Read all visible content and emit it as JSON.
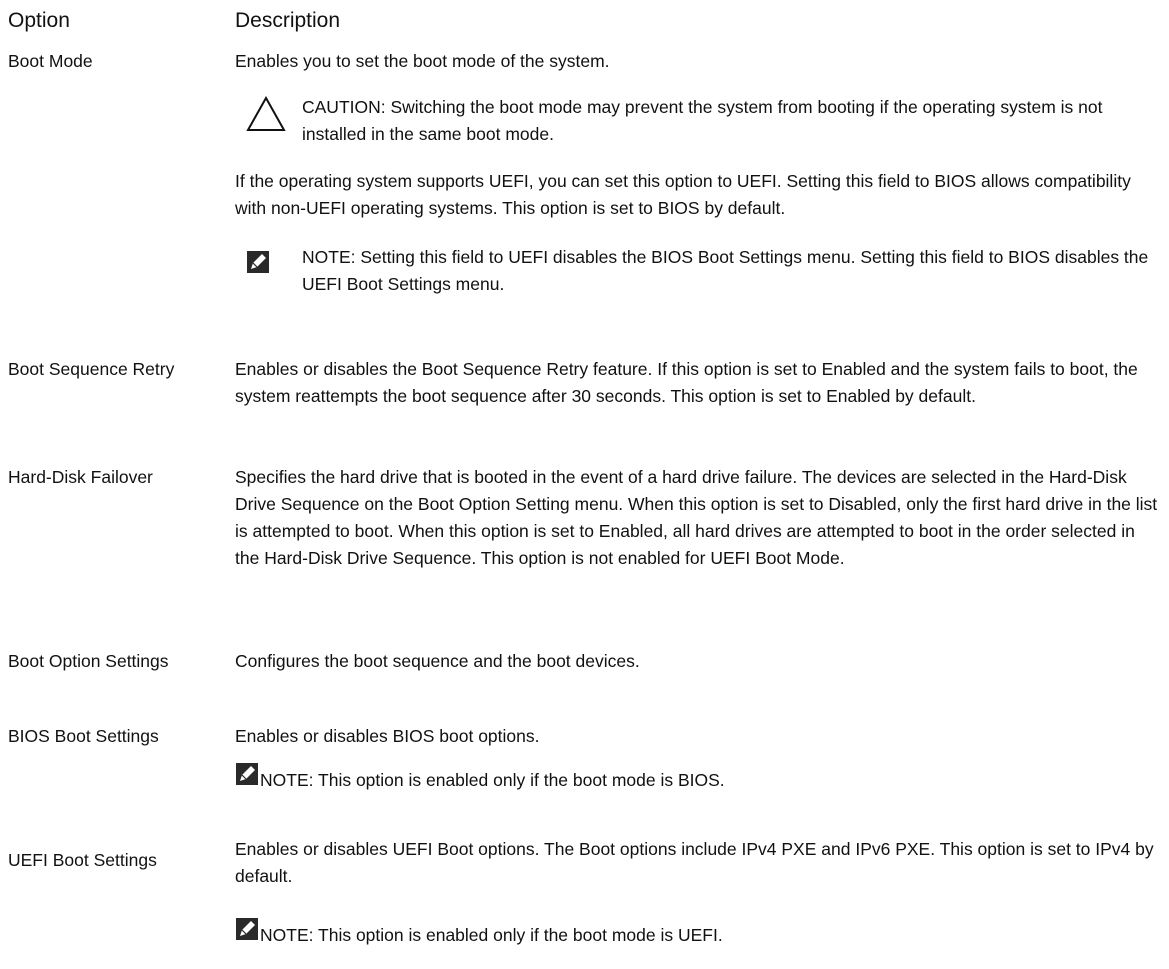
{
  "header": {
    "option": "Option",
    "description": "Description"
  },
  "rows": [
    {
      "option": "Boot Mode",
      "description": "Enables you to set the boot mode of the system.",
      "caution": "CAUTION: Switching the boot mode may prevent the system from booting if the operating system is not installed in the same boot mode.",
      "paragraph": "If the operating system supports UEFI, you can set this option to UEFI. Setting this field to BIOS allows compatibility with non-UEFI operating systems. This option is set to BIOS by default.",
      "note": "NOTE: Setting this field to UEFI disables the BIOS Boot Settings menu. Setting this field to BIOS disables the UEFI Boot Settings menu."
    },
    {
      "option": "Boot Sequence Retry",
      "description": "Enables or disables the Boot Sequence Retry feature. If this option is set to Enabled and the system fails to boot, the system reattempts the boot sequence after 30 seconds. This option is set to Enabled by default."
    },
    {
      "option": "Hard-Disk Failover",
      "description": "Specifies the hard drive that is booted in the event of a hard drive failure. The devices are selected in the Hard-Disk Drive Sequence on the Boot Option Setting menu. When this option is set to Disabled, only the first hard drive in the list is attempted to boot. When this option is set to Enabled, all hard drives are attempted to boot in the order selected in the Hard-Disk Drive Sequence. This option is not enabled for UEFI Boot Mode."
    },
    {
      "option": "Boot Option Settings",
      "description": "Configures the boot sequence and the boot devices."
    },
    {
      "option": "BIOS Boot Settings",
      "description": "Enables or disables BIOS boot options.",
      "note": "NOTE: This option is enabled only if the boot mode is BIOS."
    },
    {
      "option": "UEFI Boot Settings",
      "description": "Enables or disables UEFI Boot options. The Boot options include IPv4 PXE and IPv6 PXE. This option is set to IPv4 by default.",
      "note": "NOTE: This option is enabled only if the boot mode is UEFI."
    }
  ],
  "icons": {
    "caution": "caution-triangle-icon",
    "note": "note-pencil-icon"
  }
}
